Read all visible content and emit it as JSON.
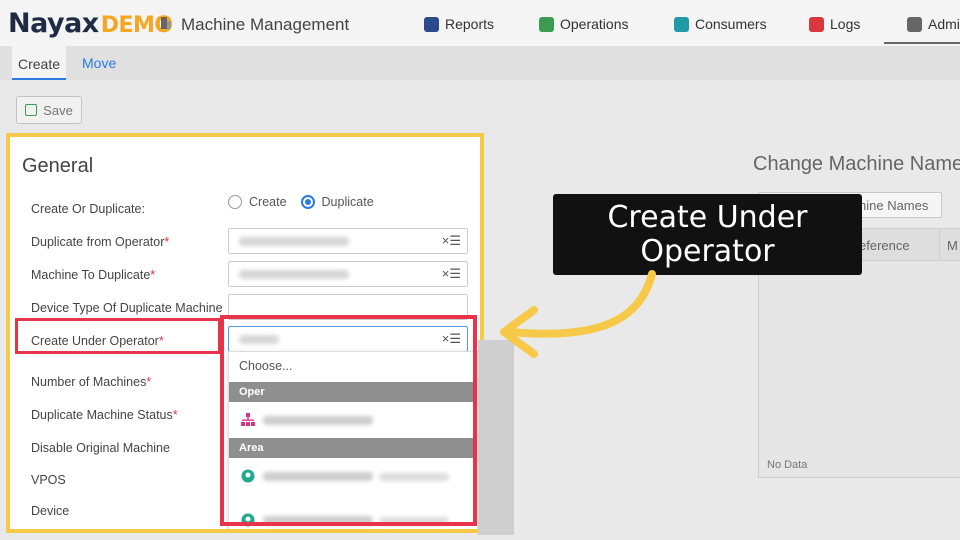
{
  "app": {
    "logo_main": "Nayax",
    "logo_suffix": "DEMO",
    "title": "Machine Management"
  },
  "nav": [
    {
      "label": "Reports",
      "color": "#2b4a8c"
    },
    {
      "label": "Operations",
      "color": "#3c9a52"
    },
    {
      "label": "Consumers",
      "color": "#1f9aa6"
    },
    {
      "label": "Logs",
      "color": "#d9363e"
    },
    {
      "label": "Admi",
      "color": "#666666"
    }
  ],
  "subtabs": {
    "create": "Create",
    "move": "Move"
  },
  "toolbar": {
    "save_label": "Save"
  },
  "general": {
    "title": "General",
    "fields": {
      "create_or_duplicate": "Create Or Duplicate:",
      "duplicate_from_operator": "Duplicate from Operator",
      "machine_to_duplicate": "Machine To Duplicate",
      "device_type": "Device Type Of Duplicate Machine",
      "create_under_operator": "Create Under Operator",
      "number_of_machines": "Number of Machines",
      "duplicate_machine_status": "Duplicate Machine Status",
      "disable_original_machine": "Disable Original Machine",
      "vpos": "VPOS",
      "device": "Device"
    },
    "required_mark": "*",
    "radio": {
      "create": "Create",
      "duplicate": "Duplicate",
      "selected": "Duplicate"
    },
    "clear_icon": "×☰"
  },
  "dropdown": {
    "choose": "Choose...",
    "group_operators": "Oper",
    "group_areas": "Area"
  },
  "right_panel": {
    "title": "Change Machine Name",
    "button": "hine Names",
    "col_reference": "eference",
    "col_m": "M",
    "no_data": "No Data"
  },
  "callout": {
    "line1": "Create Under",
    "line2": "Operator"
  },
  "colors": {
    "highlight_red": "#e8334a",
    "panel_yellow": "#f7c948",
    "accent_blue": "#2a7ae2",
    "logo_orange": "#f5a623"
  }
}
